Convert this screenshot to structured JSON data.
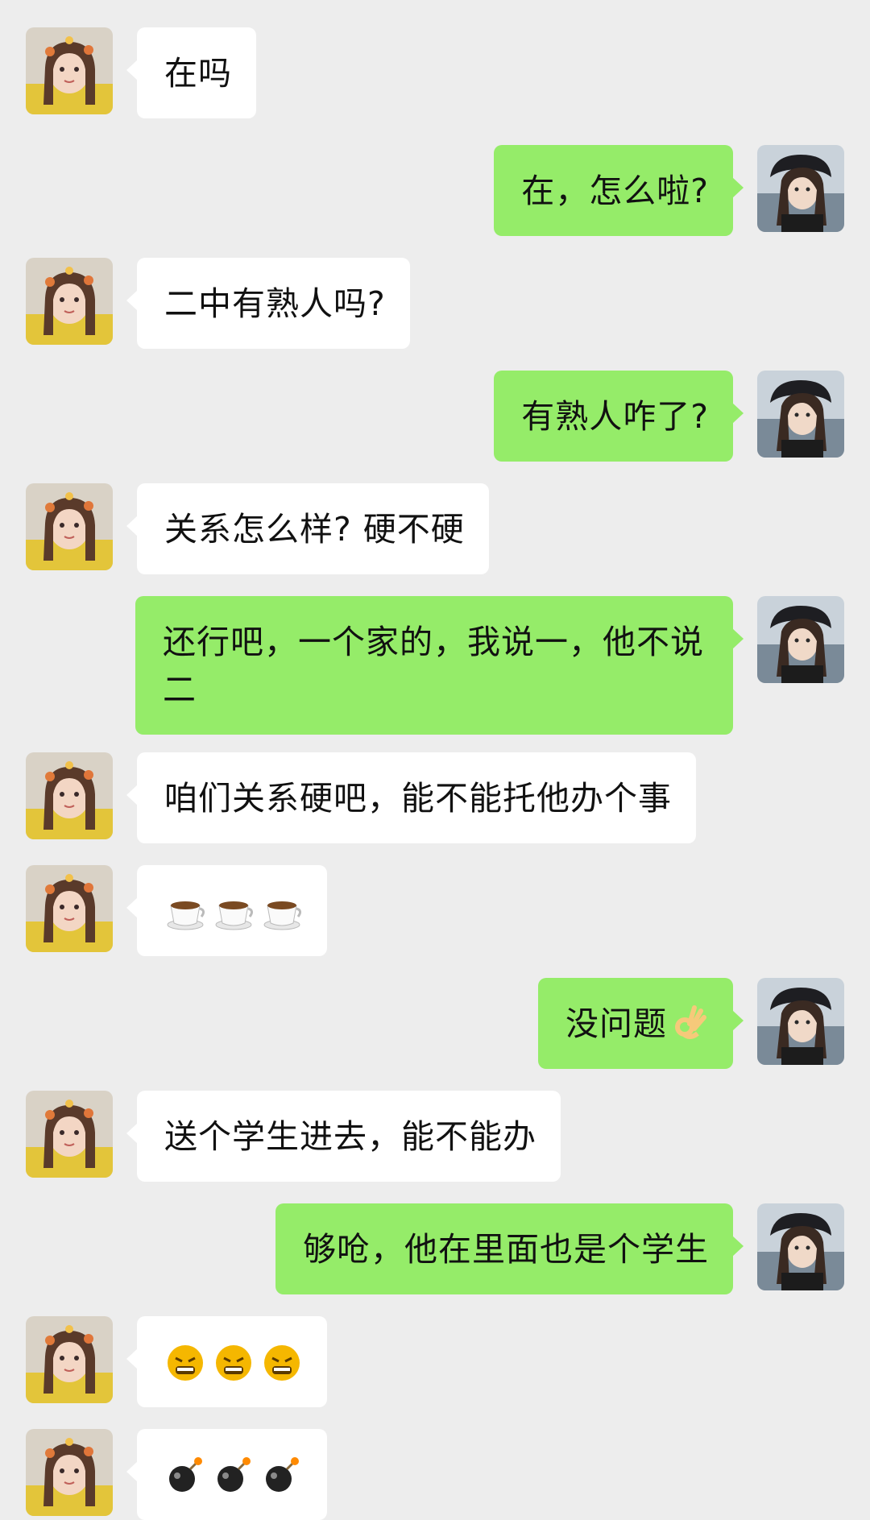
{
  "messages": [
    {
      "side": "left",
      "text": "在吗"
    },
    {
      "side": "right",
      "text": "在，怎么啦?"
    },
    {
      "side": "left",
      "text": "二中有熟人吗?"
    },
    {
      "side": "right",
      "text": "有熟人咋了?"
    },
    {
      "side": "left",
      "text": "关系怎么样? 硬不硬"
    },
    {
      "side": "right",
      "text": "还行吧，一个家的，我说一，他不说二"
    },
    {
      "side": "left",
      "text": "咱们关系硬吧，能不能托他办个事"
    },
    {
      "side": "left",
      "text": "",
      "emojis": [
        "coffee-icon",
        "coffee-icon",
        "coffee-icon"
      ]
    },
    {
      "side": "right",
      "text": "没问题",
      "inline_emoji": "ok-hand-icon"
    },
    {
      "side": "left",
      "text": "送个学生进去，能不能办"
    },
    {
      "side": "right",
      "text": "够呛，他在里面也是个学生"
    },
    {
      "side": "left",
      "text": "",
      "emojis": [
        "cursing-face-icon",
        "cursing-face-icon",
        "cursing-face-icon"
      ]
    },
    {
      "side": "left",
      "text": "",
      "emojis": [
        "bomb-icon",
        "bomb-icon",
        "bomb-icon"
      ]
    }
  ],
  "colors": {
    "background": "#ededed",
    "sent_bubble": "#95ec69",
    "received_bubble": "#ffffff",
    "text": "#111111"
  }
}
